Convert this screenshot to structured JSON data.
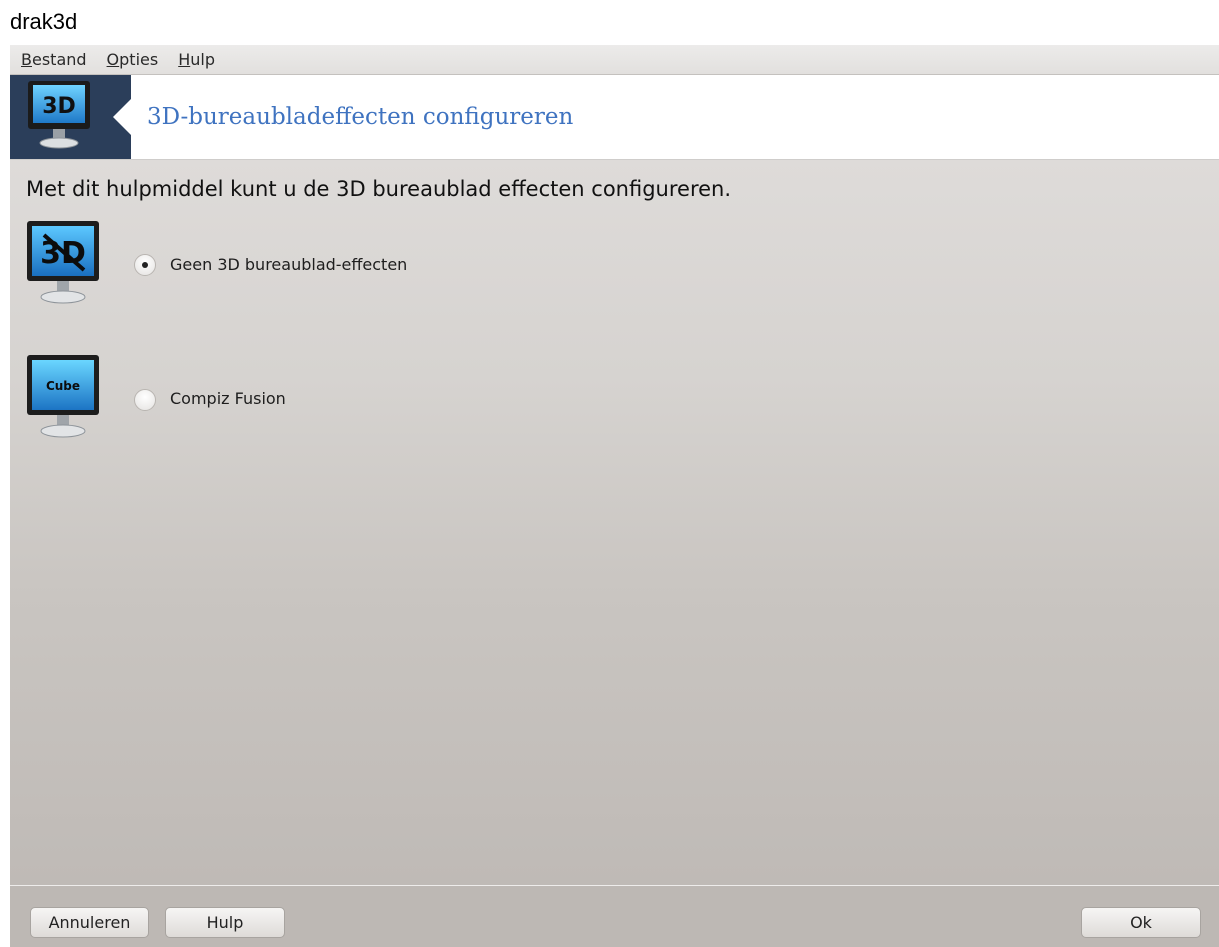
{
  "page": {
    "title": "drak3d"
  },
  "menubar": {
    "items": [
      {
        "mnemonic": "B",
        "rest": "estand"
      },
      {
        "mnemonic": "O",
        "rest": "pties"
      },
      {
        "mnemonic": "H",
        "rest": "ulp"
      }
    ]
  },
  "banner": {
    "icon": "3d-monitor-icon",
    "icon_text": "3D",
    "title": "3D-bureaubladeffecten configureren"
  },
  "main": {
    "intro": "Met dit hulpmiddel kunt u de 3D bureaublad effecten configureren.",
    "options": [
      {
        "label": "Geen 3D bureaublad-effecten",
        "selected": true,
        "icon": "no-3d-monitor-icon",
        "icon_text": "3D"
      },
      {
        "label": "Compiz Fusion",
        "selected": false,
        "icon": "cube-monitor-icon",
        "icon_text": "Cube"
      }
    ]
  },
  "footer": {
    "cancel_label": "Annuleren",
    "help_label": "Hulp",
    "ok_label": "Ok"
  },
  "colors": {
    "banner_title": "#3f73c0",
    "banner_icon_bg": "#2b3e5a"
  }
}
